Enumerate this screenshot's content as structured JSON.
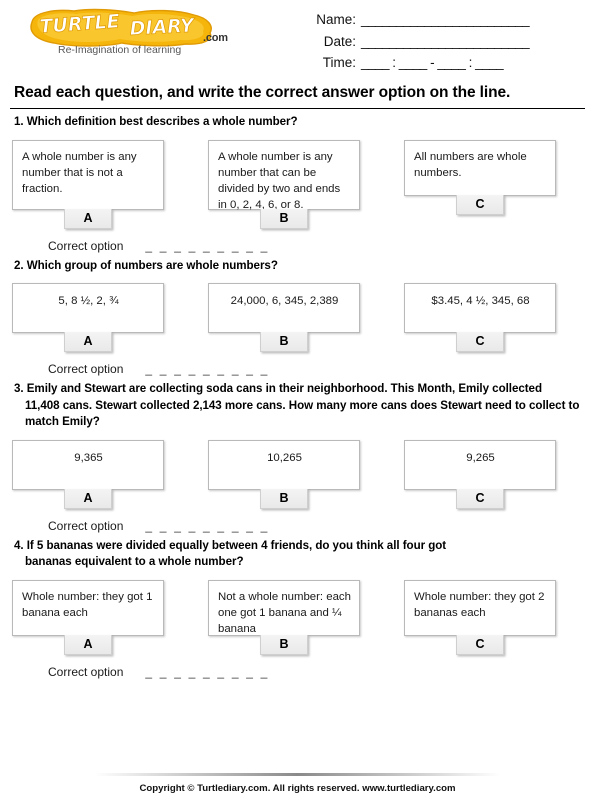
{
  "brand": {
    "logo_text_1": "TURTLE",
    "logo_text_2": "DIARY",
    "dotcom": ".com",
    "tagline": "Re-Imagination of learning",
    "logo_color": "#f5b50a",
    "logo_highlight": "#fcd34a"
  },
  "header_fields": {
    "name_label": "Name:",
    "name_rule": "________________________",
    "date_label": "Date:",
    "date_rule": "________________________",
    "time_label": "Time:",
    "time_rule": "____ : ____ - ____ : ____"
  },
  "instruction": "Read each question, and write the correct answer option on the line.",
  "correct_option_label": "Correct option",
  "correct_option_dashes": "_ _ _ _ _ _ _ _ _",
  "questions": [
    {
      "number": "1.",
      "text": "Which definition best describes a whole number?",
      "text_line2": "",
      "options": [
        {
          "letter": "A",
          "text": "A whole number is any number that is not a fraction."
        },
        {
          "letter": "B",
          "text": "A whole number is any number that can be divided by two and ends in 0, 2, 4, 6, or 8."
        },
        {
          "letter": "C",
          "text": "All numbers are whole numbers."
        }
      ]
    },
    {
      "number": "2.",
      "text": "Which group of numbers are whole numbers?",
      "text_line2": "",
      "options": [
        {
          "letter": "A",
          "text": "5, 8 ½, 2, ¾"
        },
        {
          "letter": "B",
          "text": "24,000, 6, 345, 2,389"
        },
        {
          "letter": "C",
          "text": "$3.45, 4 ½, 345, 68"
        }
      ]
    },
    {
      "number": "3.",
      "text": "Emily and Stewart are collecting soda cans in their neighborhood. This Month, Emily collected",
      "text_line2": "11,408 cans. Stewart collected 2,143 more cans.  How many more cans does Stewart need to collect to match Emily?",
      "options": [
        {
          "letter": "A",
          "text": "9,365"
        },
        {
          "letter": "B",
          "text": "10,265"
        },
        {
          "letter": "C",
          "text": "9,265"
        }
      ]
    },
    {
      "number": "4.",
      "text": "If 5 bananas were divided equally between 4 friends, do you think all four got",
      "text_line2": "bananas equivalent to a whole number?",
      "options": [
        {
          "letter": "A",
          "text": "Whole number: they got 1 banana each"
        },
        {
          "letter": "B",
          "text": "Not a whole number: each one got 1 banana and ¼ banana"
        },
        {
          "letter": "C",
          "text": "Whole number: they got 2 bananas each"
        }
      ]
    }
  ],
  "footer": "Copyright © Turtlediary.com. All rights reserved. www.turtlediary.com"
}
